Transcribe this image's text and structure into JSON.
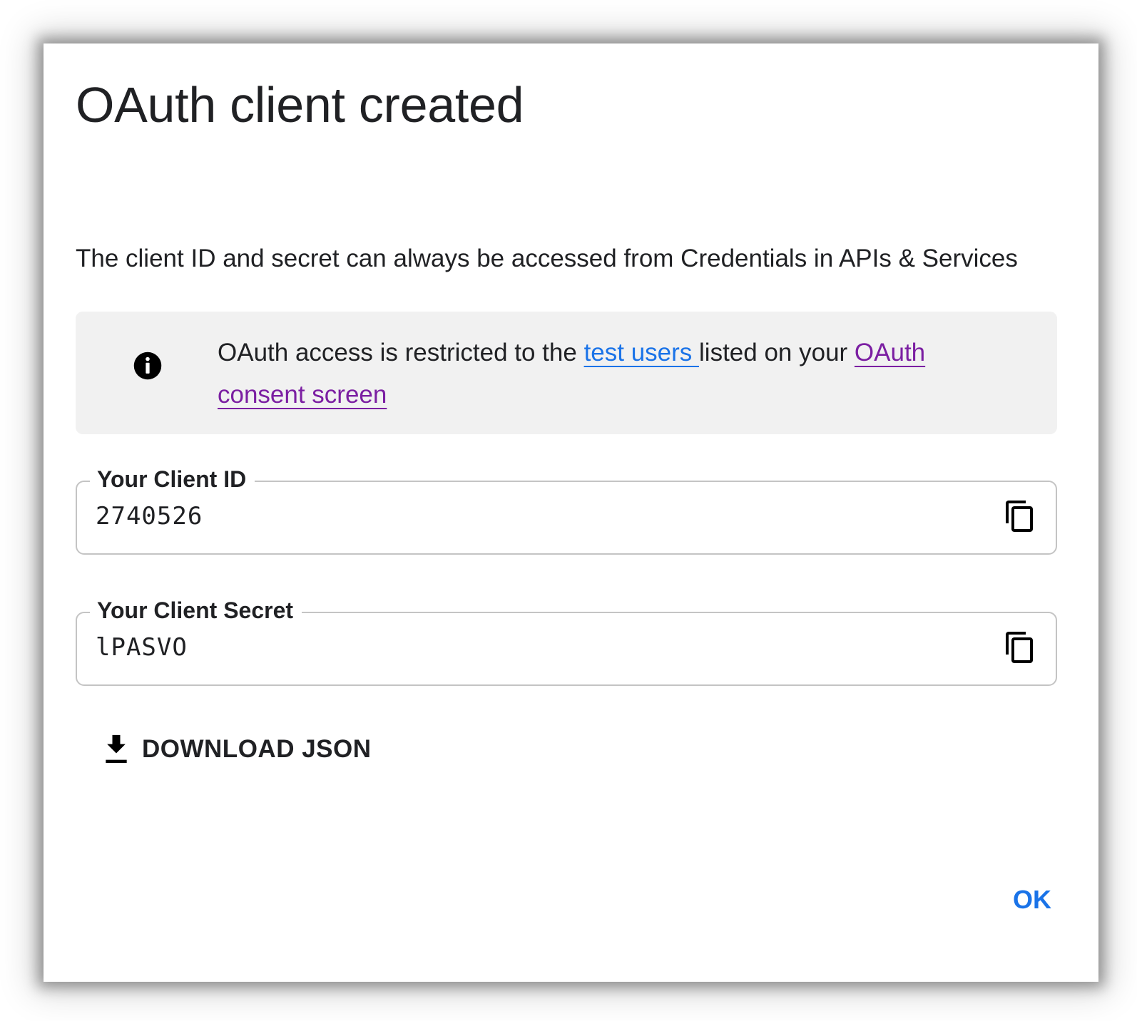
{
  "dialog": {
    "title": "OAuth client created",
    "description": "The client ID and secret can always be accessed from Credentials in APIs & Services"
  },
  "info_banner": {
    "icon": "info-icon",
    "text_before": "OAuth access is restricted to the ",
    "link_test_users": "test users ",
    "text_middle": "listed on your ",
    "link_consent_screen": "OAuth consent screen"
  },
  "client_id_field": {
    "label": "Your Client ID",
    "value": "2740526",
    "copy_icon": "copy-icon"
  },
  "client_secret_field": {
    "label": "Your Client Secret",
    "value": "lPASVO",
    "copy_icon": "copy-icon"
  },
  "actions": {
    "download_label": "DOWNLOAD JSON",
    "download_icon": "download-icon",
    "ok_label": "OK"
  },
  "colors": {
    "link_blue": "#1a73e8",
    "link_visited": "#7b1fa2",
    "banner_bg": "#f1f1f1",
    "primary_button": "#1a73e8"
  }
}
